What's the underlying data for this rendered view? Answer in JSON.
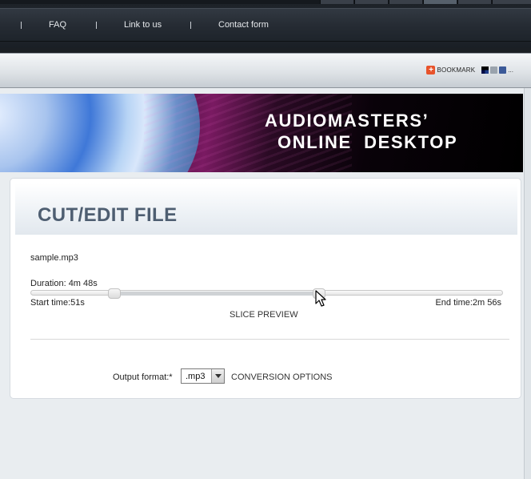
{
  "nav": {
    "links": [
      {
        "label": "FAQ"
      },
      {
        "label": "Link to us"
      },
      {
        "label": "Contact form"
      }
    ]
  },
  "bookmark": {
    "label": "BOOKMARK",
    "more": "..."
  },
  "banner": {
    "line1": "AUDIOMASTERS’",
    "line2": "ONLINE  DESKTOP"
  },
  "editor": {
    "title": "CUT/EDIT FILE",
    "filename": "sample.mp3",
    "duration": "Duration: 4m 48s",
    "start_time": "Start time:51s",
    "end_time": "End time:2m 56s",
    "slice_preview": "SLICE PREVIEW",
    "start_fraction": 0.177,
    "end_fraction": 0.611
  },
  "output": {
    "label": "Output format:*",
    "selected": ".mp3",
    "conversion_options": "CONVERSION OPTIONS"
  },
  "colors": {
    "title": "#4e5e71",
    "bookmark_accent": "#e8532b"
  }
}
